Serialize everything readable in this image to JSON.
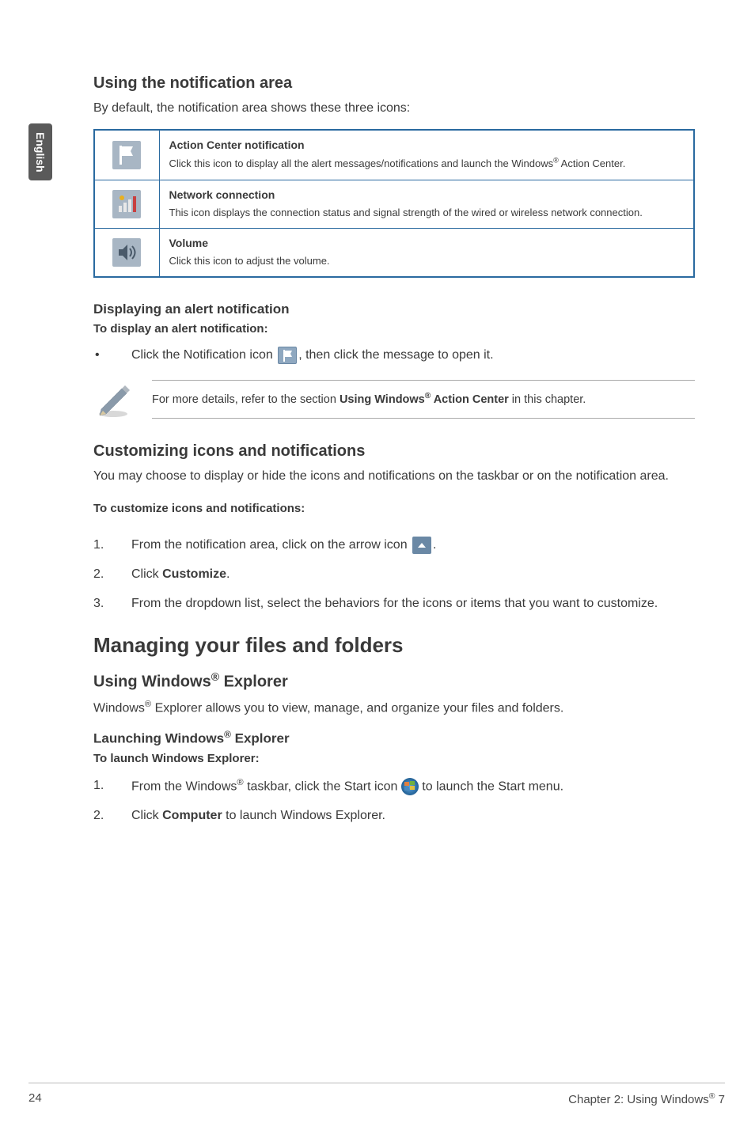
{
  "side_tab": "English",
  "section1": {
    "title": "Using the notification area",
    "intro": "By default, the notification area shows these three icons:"
  },
  "icon_rows": [
    {
      "title": "Action Center notification",
      "desc_pre": "Click this icon to display all the alert messages/notifications and launch the Windows",
      "desc_post": " Action Center."
    },
    {
      "title": "Network connection",
      "desc": "This icon displays the connection status and signal strength of the wired or wireless network connection."
    },
    {
      "title": "Volume",
      "desc": "Click this icon to adjust the volume."
    }
  ],
  "alert": {
    "heading": "Displaying an alert notification",
    "subhead": "To display an alert notification:",
    "bullet_pre": "Click the Notification icon ",
    "bullet_post": ", then click the message to open it."
  },
  "note": {
    "prefix": "For more details, refer to the section ",
    "bold1": "Using Windows",
    "bold2": " Action Center",
    "suffix": " in this chapter."
  },
  "custom": {
    "title": "Customizing icons and notifications",
    "intro": "You may choose to display or hide the icons and notifications on the taskbar or on the notification area.",
    "subhead": "To customize icons and notifications:",
    "step1_pre": "From the notification area, click on the arrow icon ",
    "step1_post": ".",
    "step2_pre": "Click ",
    "step2_bold": "Customize",
    "step2_post": ".",
    "step3": "From the dropdown list, select the behaviors for the icons or items that you want to customize."
  },
  "files": {
    "title": "Managing your files and folders",
    "sub1_pre": "Using Windows",
    "sub1_post": " Explorer",
    "intro_pre": "Windows",
    "intro_post": " Explorer allows you to view, manage, and organize your files and folders.",
    "sub2_pre": "Launching Windows",
    "sub2_post": " Explorer",
    "subhead": "To launch Windows Explorer:",
    "step1_pre": "From the Windows",
    "step1_mid": " taskbar, click the Start icon ",
    "step1_post": " to launch the Start menu.",
    "step2_pre": "Click ",
    "step2_bold": "Computer",
    "step2_post": " to launch Windows Explorer."
  },
  "footer": {
    "page": "24",
    "chapter_pre": "Chapter 2: Using Windows",
    "chapter_post": " 7"
  }
}
